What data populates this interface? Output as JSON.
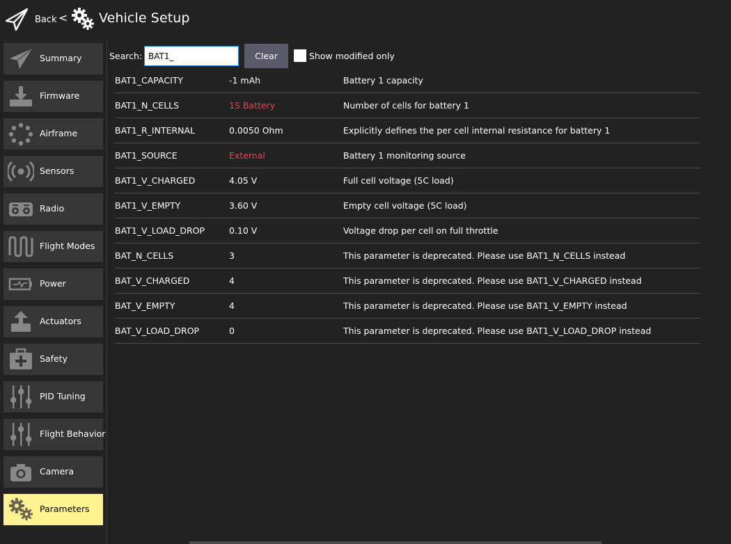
{
  "header": {
    "back_label": "Back",
    "separator": "<",
    "title": "Vehicle Setup"
  },
  "sidebar": {
    "items": [
      {
        "label": "Summary",
        "icon": "paper-plane-icon",
        "active": false
      },
      {
        "label": "Firmware",
        "icon": "download-icon",
        "active": false
      },
      {
        "label": "Airframe",
        "icon": "dots-circle-icon",
        "active": false
      },
      {
        "label": "Sensors",
        "icon": "radio-waves-icon",
        "active": false
      },
      {
        "label": "Radio",
        "icon": "transmitter-icon",
        "active": false
      },
      {
        "label": "Flight Modes",
        "icon": "wave-icon",
        "active": false
      },
      {
        "label": "Power",
        "icon": "battery-icon",
        "active": false
      },
      {
        "label": "Actuators",
        "icon": "upload-box-icon",
        "active": false
      },
      {
        "label": "Safety",
        "icon": "medkit-icon",
        "active": false
      },
      {
        "label": "PID Tuning",
        "icon": "sliders-icon",
        "active": false
      },
      {
        "label": "Flight Behavior",
        "icon": "sliders-icon",
        "active": false
      },
      {
        "label": "Camera",
        "icon": "camera-icon",
        "active": false
      },
      {
        "label": "Parameters",
        "icon": "gears-icon",
        "active": true
      }
    ]
  },
  "search": {
    "label": "Search:",
    "value": "BAT1_",
    "clear_label": "Clear",
    "modified_label": "Show modified only",
    "modified_checked": false
  },
  "parameters": [
    {
      "name": "BAT1_CAPACITY",
      "value": "-1 mAh",
      "description": "Battery 1 capacity",
      "nondefault": false
    },
    {
      "name": "BAT1_N_CELLS",
      "value": "1S Battery",
      "description": "Number of cells for battery 1",
      "nondefault": true
    },
    {
      "name": "BAT1_R_INTERNAL",
      "value": "0.0050 Ohm",
      "description": "Explicitly defines the per cell internal resistance for battery 1",
      "nondefault": false
    },
    {
      "name": "BAT1_SOURCE",
      "value": "External",
      "description": "Battery 1 monitoring source",
      "nondefault": true
    },
    {
      "name": "BAT1_V_CHARGED",
      "value": "4.05 V",
      "description": "Full cell voltage (5C load)",
      "nondefault": false
    },
    {
      "name": "BAT1_V_EMPTY",
      "value": "3.60 V",
      "description": "Empty cell voltage (5C load)",
      "nondefault": false
    },
    {
      "name": "BAT1_V_LOAD_DROP",
      "value": "0.10 V",
      "description": "Voltage drop per cell on full throttle",
      "nondefault": false
    },
    {
      "name": "BAT_N_CELLS",
      "value": "3",
      "description": "This parameter is deprecated. Please use BAT1_N_CELLS instead",
      "nondefault": false
    },
    {
      "name": "BAT_V_CHARGED",
      "value": "4",
      "description": "This parameter is deprecated. Please use BAT1_V_CHARGED instead",
      "nondefault": false
    },
    {
      "name": "BAT_V_EMPTY",
      "value": "4",
      "description": "This parameter is deprecated. Please use BAT1_V_EMPTY instead",
      "nondefault": false
    },
    {
      "name": "BAT_V_LOAD_DROP",
      "value": "0",
      "description": "This parameter is deprecated. Please use BAT1_V_LOAD_DROP instead",
      "nondefault": false
    }
  ],
  "colors": {
    "background": "#222222",
    "nav_item": "#363636",
    "nav_active": "#fff291",
    "nondefault_value": "#e8454e",
    "clear_button": "#5a5a6a",
    "row_divider": "#4a4a4a"
  }
}
